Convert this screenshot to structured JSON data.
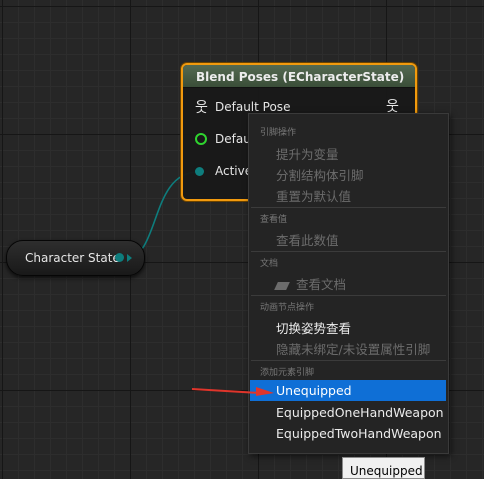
{
  "getter_node": {
    "label": "Character State",
    "pin_color": "#0e7d7d"
  },
  "blend_node": {
    "title": "Blend Poses (ECharacterState)",
    "accent": "#f29a0e",
    "pins": {
      "default_pose": "Default Pose",
      "default_blend": "Defaul",
      "active": "Active"
    }
  },
  "context_menu": {
    "section_pin_actions": "引脚操作",
    "promote_to_variable": "提升为变量",
    "split_struct_pin": "分割结构体引脚",
    "reset_to_default": "重置为默认值",
    "section_watch": "查看值",
    "watch_value": "查看此数值",
    "section_docs": "文档",
    "view_docs": "查看文档",
    "section_anim_node": "动画节点操作",
    "toggle_pose_watch": "切换姿势查看",
    "hide_unbound_pins": "隐藏未绑定/未设置属性引脚",
    "section_add_pin": "添加元素引脚",
    "options": [
      "Unequipped",
      "EquippedOneHandWeapon",
      "EquippedTwoHandWeapon"
    ],
    "selected_index": 0,
    "selection_color": "#0f6fd6"
  },
  "tooltip": {
    "text": "Unequipped"
  },
  "annotation": {
    "arrow_color": "#e0352b"
  }
}
